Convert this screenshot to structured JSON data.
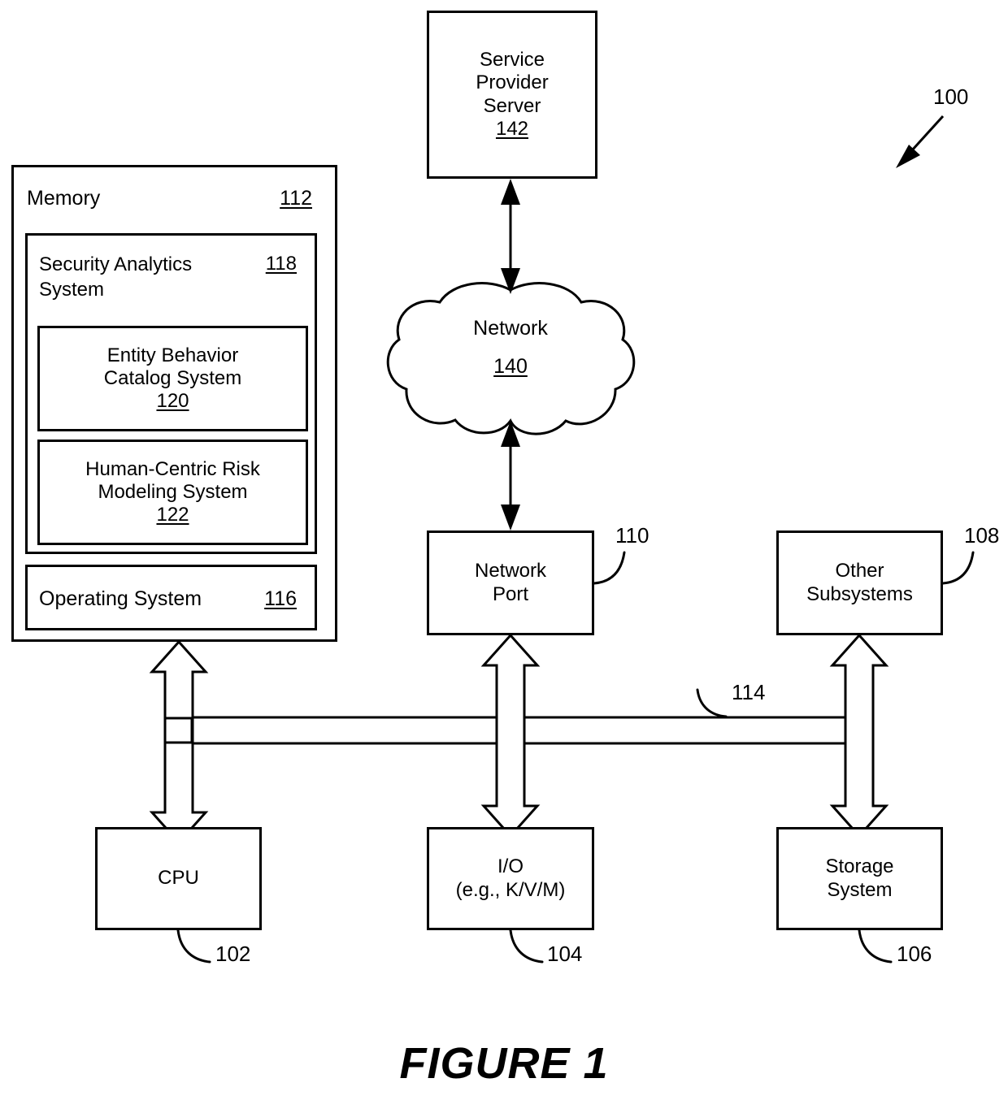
{
  "figure": {
    "caption": "FIGURE 1",
    "system_ref": "100"
  },
  "memory": {
    "label": "Memory",
    "ref": "112",
    "security_analytics": {
      "label": "Security Analytics\nSystem",
      "ref": "118",
      "children": [
        {
          "label": "Entity Behavior\nCatalog System",
          "ref": "120"
        },
        {
          "label": "Human-Centric Risk\nModeling System",
          "ref": "122"
        }
      ]
    },
    "operating_system": {
      "label": "Operating System",
      "ref": "116"
    }
  },
  "nodes": {
    "service_provider_server": {
      "label": "Service\nProvider\nServer",
      "ref": "142"
    },
    "network": {
      "label": "Network",
      "ref": "140"
    },
    "network_port": {
      "label": "Network\nPort",
      "ref": "110"
    },
    "other_subsystems": {
      "label": "Other\nSubsystems",
      "ref": "108"
    },
    "cpu": {
      "label": "CPU",
      "ref": "102"
    },
    "io": {
      "label": "I/O\n(e.g., K/V/M)",
      "ref": "104"
    },
    "storage_system": {
      "label": "Storage\nSystem",
      "ref": "106"
    }
  },
  "bus": {
    "ref": "114"
  },
  "colors": {
    "stroke": "#000000",
    "background": "#ffffff"
  }
}
